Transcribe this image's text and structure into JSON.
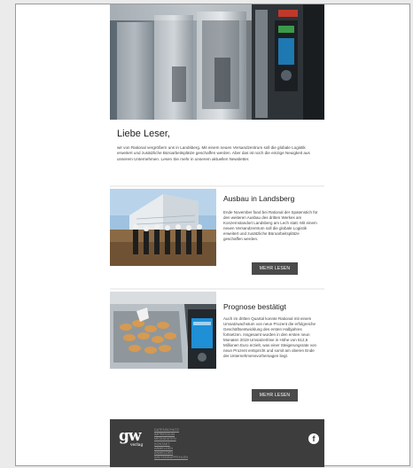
{
  "greeting": "Liebe Leser,",
  "intro": "wir von Rational vergrößern uns in Landsberg. Mit einem neuen Versandzentrum soll die globale Logistik erweitert und zusätzliche Büroarbeitsplätze geschaffen werden. Aber das ist noch die einzige Neuigkeit aus unserem Unternehmen. Lesen Sie mehr in unserem aktuellen Newsletter.",
  "articles": [
    {
      "title": "Ausbau in Landsberg",
      "body": "Ende November fand bei Rational der Spatenstich für den weiteren Ausbau des dritten Werkes am Konzernstandort Landsberg am Lech statt. Mit einem neuen Versandzentrum soll die globale Logistik erweitert und zusätzliche Büroarbeitsplätze geschaffen werden.",
      "button": "MEHR LESEN"
    },
    {
      "title": "Prognose bestätigt",
      "body": "Auch im dritten Quartal konnte Rational mit einem Umsatzwachstum von neun Prozent die erfolgreiche Geschäftsentwicklung des ersten Halbjahres fortsetzen. Insgesamt wurden in den ersten neun Monaten 2019 Umsatzerlöse in Höhe von 612,6 Millionen Euro erzielt, was einer Steigerungsrate von neun Prozent entspricht und somit am oberen Ende der Unternehmensvorhersagen liegt.",
      "button": "MEHR LESEN"
    }
  ],
  "footer": {
    "logo": "gw",
    "logo_sub": "verlag",
    "links": [
      "DATENSCHUTZ",
      "IMPRESSUM",
      "MEDIADATEN",
      "KONTAKT",
      "ABMELDEN",
      "ANMELDEN",
      "WEITEREMPFEHLEN"
    ],
    "facebook_icon": "facebook-icon"
  },
  "colors": {
    "page_background": "#ebebeb",
    "button": "#4a4a4a",
    "footer": "#3d3d3d",
    "oven_display": "#1f8fd6"
  }
}
